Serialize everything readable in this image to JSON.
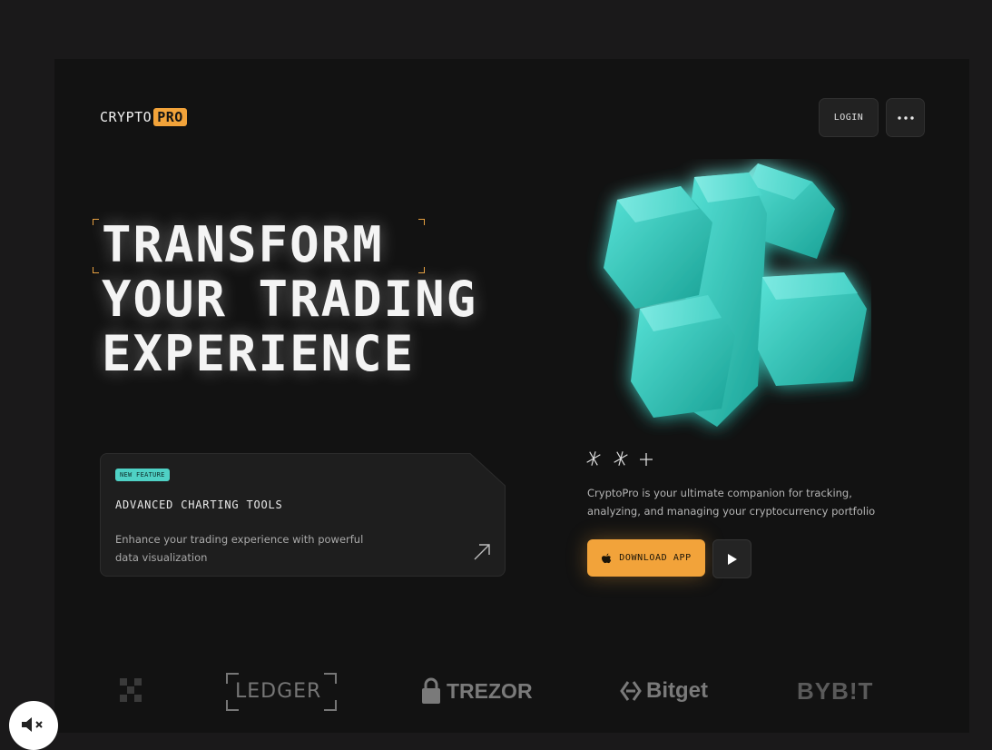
{
  "header": {
    "logo_text": "CRYPTO",
    "logo_badge": "PRO",
    "login_label": "LOGIN",
    "menu_icon": "more-dots-icon"
  },
  "hero": {
    "title_lines": [
      "TRANSFORM",
      "YOUR TRADING",
      "EXPERIENCE"
    ]
  },
  "feature_card": {
    "badge": "NEW FEATURE",
    "title": "ADVANCED CHARTING TOOLS",
    "description": "Enhance your trading experience with powerful data visualization",
    "icon": "arrow-up-right-icon"
  },
  "promo": {
    "sparkles": "sparkle-icons",
    "tagline": "CryptoPro is your ultimate companion for tracking, analyzing, and managing your cryptocurrency portfolio",
    "download_label": "DOWNLOAD APP",
    "download_icon": "apple-icon",
    "play_icon": "play-icon"
  },
  "brands": {
    "ledger": "LEDGER",
    "trezor": "TREZOR",
    "bitget": "Bitget",
    "bybit": "BYB!T"
  },
  "colors": {
    "accent": "#f2a33a",
    "teal": "#4fd1c5",
    "background": "#121212"
  }
}
